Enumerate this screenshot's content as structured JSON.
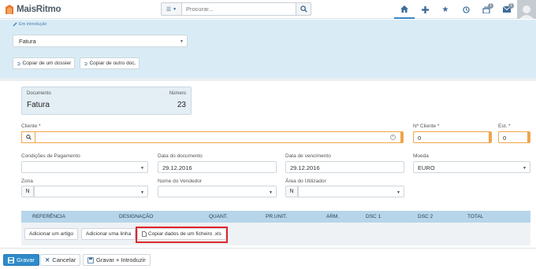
{
  "app": {
    "name": "MaisRitmo"
  },
  "search": {
    "placeholder": "Procurar..."
  },
  "topbar": {
    "icons": [
      "home-icon",
      "plus-icon",
      "star-icon",
      "clock-icon",
      "inbox-icon",
      "mail-icon"
    ],
    "inbox_badge": "1",
    "mail_badge": "1"
  },
  "header": {
    "status": "Em introdução",
    "doc_type": "Fatura",
    "copy_dossier": "Copiar de um dossier",
    "copy_other": "Copiar de outro doc."
  },
  "doc_card": {
    "doc_label": "Documento",
    "num_label": "Número",
    "doc_value": "Fatura",
    "num_value": "23"
  },
  "form": {
    "cliente_label": "Cliente *",
    "cliente_value": "",
    "ncliente_label": "Nº Cliente *",
    "ncliente_value": "0",
    "est_label": "Est. *",
    "est_value": "0",
    "cond_pag_label": "Condições de Pagamento",
    "cond_pag_value": "",
    "data_doc_label": "Data do documento",
    "data_doc_value": "29.12.2016",
    "data_venc_label": "Data de vencimento",
    "data_venc_value": "29.12.2016",
    "moeda_label": "Moeda",
    "moeda_value": "EURO",
    "zona_label": "Zona",
    "zona_prefix": "N",
    "vendedor_label": "Nome do Vendedor",
    "area_label": "Área do Utilizador",
    "area_prefix": "N"
  },
  "grid": {
    "columns": [
      "REFERÊNCIA",
      "DESIGNAÇÃO",
      "QUANT.",
      "PR.UNIT.",
      "ARM.",
      "DSC 1",
      "DSC 2",
      "TOTAL"
    ],
    "add_article": "Adicionar um artigo",
    "add_line": "Adicionar uma linha",
    "copy_xls": "Copiar dados de um ficheiro .xls"
  },
  "footer": {
    "save": "Gravar",
    "cancel": "Cancelar",
    "save_new": "Gravar + Introduzir"
  },
  "colors": {
    "accent": "#2e8bc9",
    "header_bg": "#d9ecf6",
    "required": "#f0a44a",
    "highlight": "#e0262a"
  }
}
